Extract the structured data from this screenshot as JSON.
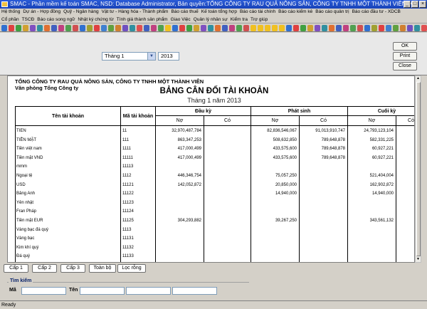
{
  "window": {
    "title": "SMAC - Phần mềm kế toán SMAC, NSD: Database Administrator, Bản quyền:TỔNG CÔNG TY RAU QUẢ NÔNG SẢN, CÔNG TY TNHH MỘT THÀNH VIÊN, K..."
  },
  "menu": [
    "Hệ thống",
    "Dự án - Hợp đồng",
    "Quỹ - Ngân hàng",
    "Vật tư - Hàng hóa - Thành phẩm",
    "Báo cáo thuế",
    "Kế toán tổng hợp",
    "Báo cáo tài chính",
    "Báo cáo kiểm kê",
    "Báo cáo quản trị",
    "Báo cáo đầu tư - XDCB"
  ],
  "iconbar": [
    "Cổ phần",
    "TSCĐ",
    "Báo cáo song ngữ",
    "Nhật ký chứng từ",
    "Tính giá thành sản phẩm",
    "Giao Việc",
    "Quản lý nhân sự",
    "Kiểm tra",
    "Trợ giúp"
  ],
  "toolbar_colors": [
    "#3070d0",
    "#e04040",
    "#40a040",
    "#d0a030",
    "#8050c0",
    "#3090a0",
    "#e07030",
    "#4060c0",
    "#c04080",
    "#50a050",
    "#d05050",
    "#3070d0",
    "#a0a030",
    "#e04040",
    "#4080d0",
    "#60a040",
    "#d08030",
    "#7050c0",
    "#3090a0",
    "#e05050",
    "#4060c0",
    "#c04080",
    "#50a050",
    "#f0c020",
    "#3070d0",
    "#e04040",
    "#40a040",
    "#d0a030",
    "#8050c0",
    "#3090a0",
    "#e07030",
    "#4060c0",
    "#c04080",
    "#50a050",
    "#d05050",
    "#f0c020",
    "#f0c020",
    "#f0c020",
    "#f0c020",
    "#f0c020",
    "#3070d0",
    "#e04040",
    "#40a040",
    "#d0a030",
    "#8050c0",
    "#3090a0",
    "#e07030",
    "#4060c0",
    "#c04080",
    "#50a050",
    "#d05050",
    "#3070d0",
    "#a0a030",
    "#e04040",
    "#4080d0",
    "#60a040",
    "#d08030",
    "#7050c0",
    "#3090a0",
    "#e05050"
  ],
  "filter": {
    "month": "Tháng 1",
    "year": "2013"
  },
  "buttons": {
    "ok": "OK",
    "print": "Print",
    "close": "Close"
  },
  "report": {
    "company": "TỔNG CÔNG TY RAU QUẢ NÔNG SẢN, CÔNG TY TNHH MỘT THÀNH VIÊN",
    "dept": "Văn phòng Tổng Công ty",
    "title": "BẢNG CÂN ĐỐI TÀI KHOẢN",
    "subtitle": "Tháng 1 năm 2013",
    "headers": {
      "name": "Tên tài khoản",
      "account": "Mã tài khoản",
      "opening": "Đầu kỳ",
      "period": "Phát sinh",
      "closing": "Cuối kỳ",
      "debit": "Nợ",
      "credit": "Có"
    },
    "rows": [
      {
        "name": "TIEN",
        "acc": "11",
        "od": "32,970,487,784",
        "oc": "",
        "pd": "82,836,546,067",
        "pc": "91,013,910,747",
        "cd": "24,793,123,104"
      },
      {
        "name": "TIỀN MẶT",
        "acc": "111",
        "od": "863,347,253",
        "oc": "",
        "pd": "508,632,850",
        "pc": "789,648,878",
        "cd": "582,331,225"
      },
      {
        "name": "Tiền việt nam",
        "acc": "1111",
        "od": "417,000,499",
        "oc": "",
        "pd": "433,575,600",
        "pc": "789,648,878",
        "cd": "60,927,221"
      },
      {
        "name": "Tiền mặt VND",
        "acc": "11111",
        "od": "417,000,499",
        "oc": "",
        "pd": "433,575,600",
        "pc": "789,648,878",
        "cd": "60,927,221"
      },
      {
        "name": "mmm",
        "acc": "11113",
        "od": "",
        "oc": "",
        "pd": "",
        "pc": "",
        "cd": ""
      },
      {
        "name": "Ngoại tệ",
        "acc": "1112",
        "od": "446,346,754",
        "oc": "",
        "pd": "75,057,250",
        "pc": "",
        "cd": "521,404,004"
      },
      {
        "name": "USD",
        "acc": "11121",
        "od": "142,052,872",
        "oc": "",
        "pd": "20,850,000",
        "pc": "",
        "cd": "162,902,872"
      },
      {
        "name": "Bảng Anh",
        "acc": "11122",
        "od": "",
        "oc": "",
        "pd": "14,940,000",
        "pc": "",
        "cd": "14,940,000"
      },
      {
        "name": "Yên nhật",
        "acc": "11123",
        "od": "",
        "oc": "",
        "pd": "",
        "pc": "",
        "cd": ""
      },
      {
        "name": "Fran Pháp",
        "acc": "11124",
        "od": "",
        "oc": "",
        "pd": "",
        "pc": "",
        "cd": ""
      },
      {
        "name": "Tiền mặt EUR",
        "acc": "11125",
        "od": "304,293,882",
        "oc": "",
        "pd": "39,267,250",
        "pc": "",
        "cd": "343,561,132"
      },
      {
        "name": "Vàng bạc đá quý",
        "acc": "1113",
        "od": "",
        "oc": "",
        "pd": "",
        "pc": "",
        "cd": ""
      },
      {
        "name": "Vàng bạc",
        "acc": "11131",
        "od": "",
        "oc": "",
        "pd": "",
        "pc": "",
        "cd": ""
      },
      {
        "name": "Kim khí quý",
        "acc": "11132",
        "od": "",
        "oc": "",
        "pd": "",
        "pc": "",
        "cd": ""
      },
      {
        "name": "Đá quý",
        "acc": "11133",
        "od": "",
        "oc": "",
        "pd": "",
        "pc": "",
        "cd": ""
      }
    ]
  },
  "tabs": [
    "Cấp 1",
    "Cấp 2",
    "Cấp 3",
    "Toàn bộ",
    "Lọc rỗng"
  ],
  "search": {
    "legend": "Tìm kiếm",
    "code_label": "Mã",
    "name_label": "Tên"
  },
  "status": "Ready"
}
